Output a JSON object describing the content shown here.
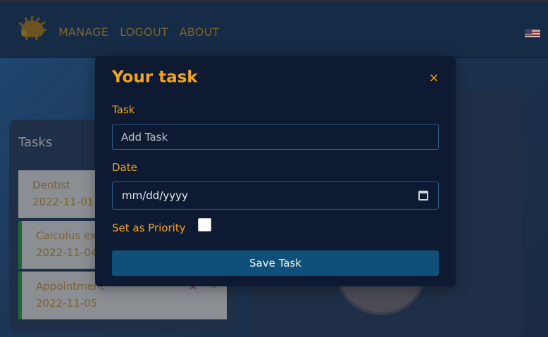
{
  "nav": {
    "items": [
      "MANAGE",
      "LOGOUT",
      "ABOUT"
    ]
  },
  "tasks": {
    "title": "Tasks",
    "items": [
      {
        "name": "Dentist",
        "date": "2022-11-01",
        "priority": false
      },
      {
        "name": "Calculus exa",
        "date": "2022-11-04",
        "priority": true
      },
      {
        "name": "Appointment",
        "date": "2022-11-05",
        "priority": true
      }
    ]
  },
  "modal": {
    "title": "Your task",
    "close": "×",
    "task_label": "Task",
    "task_placeholder": "Add Task",
    "date_label": "Date",
    "date_placeholder": "mm/dd/yyyy",
    "priority_label": "Set as Priority",
    "priority_checked": false,
    "save_label": "Save Task"
  },
  "colors": {
    "accent": "#f5a51c",
    "button": "#0e5079",
    "modal_bg": "#0d1a31"
  }
}
